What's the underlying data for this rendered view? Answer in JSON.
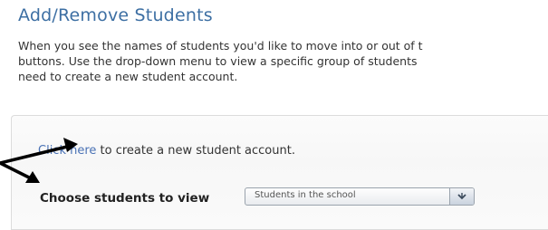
{
  "header": {
    "title": "Add/Remove Students"
  },
  "intro": {
    "line1": "When you see the names of students you'd like to move into or out of t",
    "line2": "buttons. Use the drop-down menu to view a specific group of students",
    "line3": "need to create a new student account."
  },
  "create": {
    "link_text": "Click here",
    "rest_text": " to create a new student account."
  },
  "filter": {
    "label": "Choose students to view",
    "selected": "Students in the school"
  },
  "icons": {
    "dropdown": "chevron-down-icon",
    "annotation": "arrow-icon"
  },
  "colors": {
    "title": "#3d6fa3",
    "link": "#4a72b5"
  }
}
